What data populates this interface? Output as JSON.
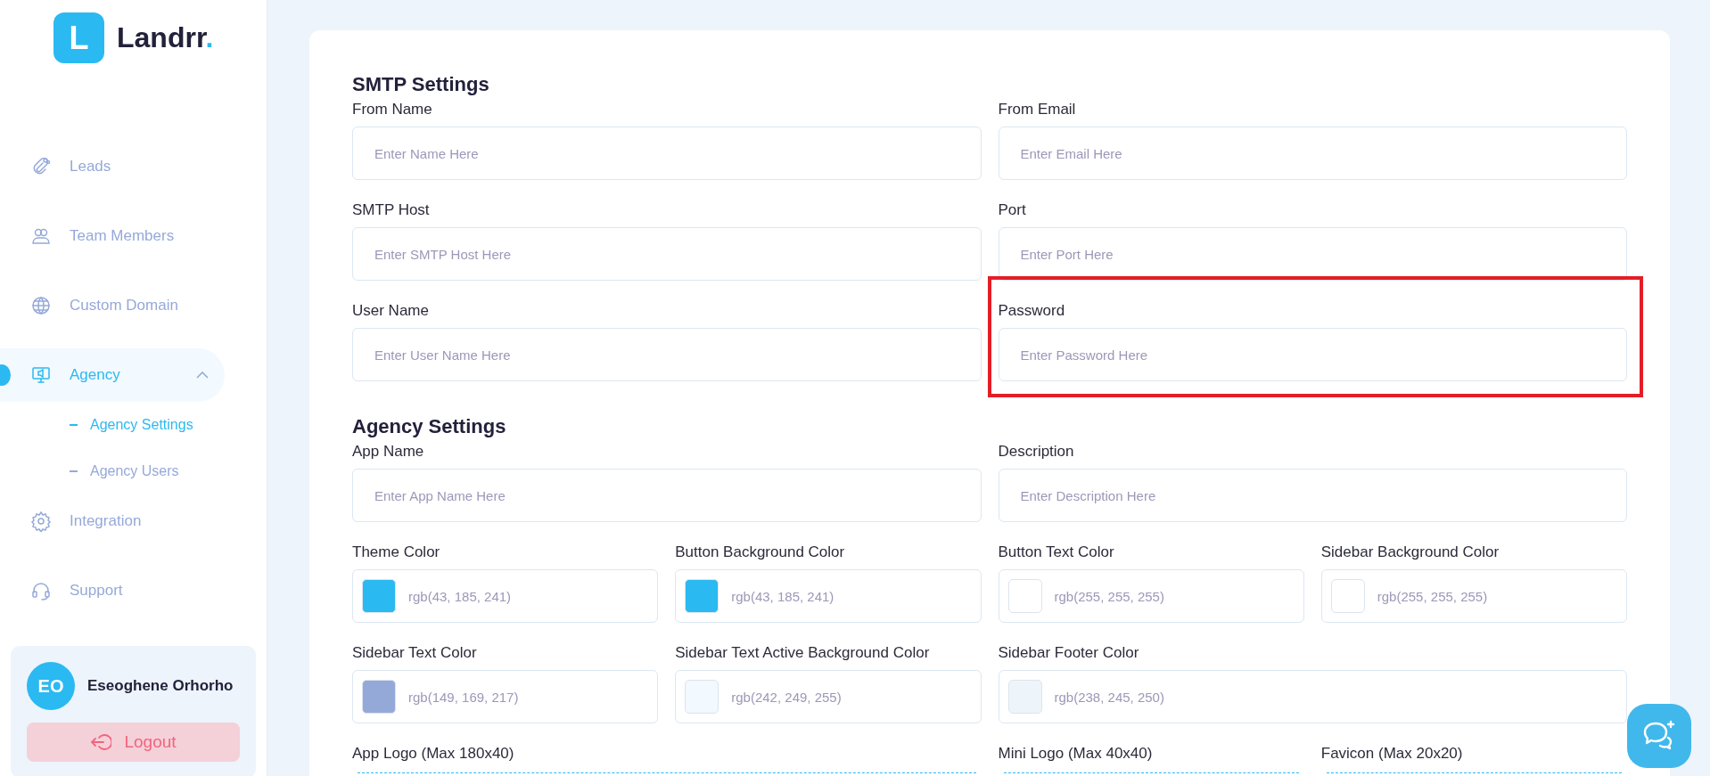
{
  "sidebar": {
    "logo": {
      "letter": "L",
      "name": "Landrr",
      "dot": "."
    },
    "nav": [
      {
        "label": "Leads",
        "selected": false
      },
      {
        "label": "Team Members",
        "selected": false
      },
      {
        "label": "Custom Domain",
        "selected": false
      },
      {
        "label": "Agency",
        "selected": true,
        "expanded": true,
        "children": [
          {
            "label": "Agency Settings",
            "selected": true
          },
          {
            "label": "Agency Users",
            "selected": false
          }
        ]
      },
      {
        "label": "Integration",
        "selected": false
      },
      {
        "label": "Support",
        "selected": false
      }
    ],
    "user": {
      "initials": "EO",
      "name": "Eseoghene Orhorho"
    },
    "logout": "Logout"
  },
  "sections": [
    {
      "title": "SMTP Settings",
      "fields": [
        {
          "label": "From Name",
          "placeholder": "Enter Name Here",
          "highlighted": false
        },
        {
          "label": "From Email",
          "placeholder": "Enter Email Here",
          "highlighted": false
        },
        {
          "label": "SMTP Host",
          "placeholder": "Enter SMTP Host Here",
          "highlighted": false
        },
        {
          "label": "Port",
          "placeholder": "Enter Port Here",
          "highlighted": false
        },
        {
          "label": "User Name",
          "placeholder": "Enter User Name Here",
          "highlighted": false
        },
        {
          "label": "Password",
          "placeholder": "Enter Password Here",
          "highlighted": true
        }
      ]
    },
    {
      "title": "Agency Settings",
      "fields": [
        {
          "label": "App Name",
          "placeholder": "Enter App Name Here",
          "highlighted": false
        },
        {
          "label": "Description",
          "placeholder": "Enter Description Here",
          "highlighted": false
        }
      ],
      "colors": [
        {
          "label": "Theme Color",
          "value": "rgb(43, 185, 241)",
          "color": "#2bb9f1"
        },
        {
          "label": "Button Background Color",
          "value": "rgb(43, 185, 241)",
          "color": "#2bb9f1"
        },
        {
          "label": "Button Text Color",
          "value": "rgb(255, 255, 255)",
          "color": "#ffffff"
        },
        {
          "label": "Sidebar Background Color",
          "value": "rgb(255, 255, 255)",
          "color": "#ffffff"
        },
        {
          "label": "Sidebar Text Color",
          "value": "rgb(149, 169, 217)",
          "color": "#95a9d9"
        },
        {
          "label": "Sidebar Text Active Background Color",
          "value": "rgb(242, 249, 255)",
          "color": "#f2f9ff"
        },
        {
          "label": "Sidebar Footer Color",
          "value": "rgb(238, 245, 250)",
          "color": "#eef5fa"
        }
      ],
      "uploads": [
        {
          "label": "App Logo (Max 180x40)"
        },
        {
          "label": "Mini Logo (Max 40x40)"
        },
        {
          "label": "Favicon (Max 20x20)"
        }
      ]
    }
  ]
}
